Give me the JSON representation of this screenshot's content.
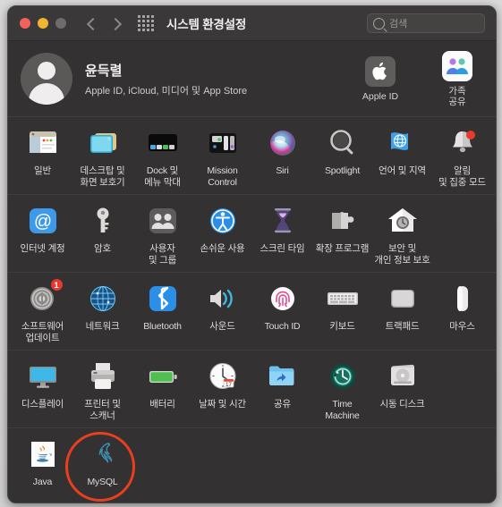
{
  "window": {
    "title": "시스템 환경설정",
    "traffic_lights": [
      "close",
      "minimize",
      "maximize"
    ],
    "nav_back": "back-arrow",
    "nav_forward": "forward-arrow",
    "grid_button": "show-all-grid",
    "search": {
      "placeholder": "검색",
      "value": ""
    }
  },
  "account": {
    "name": "윤득렬",
    "subtitle": "Apple ID, iCloud, 미디어 및 App Store",
    "avatar": "default-user-avatar",
    "actions": [
      {
        "label": "Apple ID",
        "icon": "apple-logo-icon"
      },
      {
        "label": "가족\n공유",
        "label_line1": "가족",
        "label_line2": "공유",
        "icon": "family-sharing-icon"
      }
    ]
  },
  "rows": [
    {
      "items": [
        {
          "label_line1": "일반",
          "label_line2": "",
          "icon": "general-icon"
        },
        {
          "label_line1": "데스크탑 및",
          "label_line2": "화면 보호기",
          "icon": "desktop-screensaver-icon"
        },
        {
          "label_line1": "Dock 및",
          "label_line2": "메뉴 막대",
          "icon": "dock-menubar-icon"
        },
        {
          "label_line1": "Mission",
          "label_line2": "Control",
          "icon": "mission-control-icon"
        },
        {
          "label_line1": "Siri",
          "label_line2": "",
          "icon": "siri-icon"
        },
        {
          "label_line1": "Spotlight",
          "label_line2": "",
          "icon": "spotlight-icon"
        },
        {
          "label_line1": "언어 및 지역",
          "label_line2": "",
          "icon": "language-region-icon"
        },
        {
          "label_line1": "알림",
          "label_line2": "및 집중 모드",
          "icon": "notifications-focus-icon"
        }
      ]
    },
    {
      "items": [
        {
          "label_line1": "인터넷 계정",
          "label_line2": "",
          "icon": "internet-accounts-icon"
        },
        {
          "label_line1": "암호",
          "label_line2": "",
          "icon": "passwords-icon"
        },
        {
          "label_line1": "사용자",
          "label_line2": "및 그룹",
          "icon": "users-groups-icon"
        },
        {
          "label_line1": "손쉬운 사용",
          "label_line2": "",
          "icon": "accessibility-icon"
        },
        {
          "label_line1": "스크린 타임",
          "label_line2": "",
          "icon": "screen-time-icon"
        },
        {
          "label_line1": "확장 프로그램",
          "label_line2": "",
          "icon": "extensions-icon"
        },
        {
          "label_line1": "보안 및",
          "label_line2": "개인 정보 보호",
          "icon": "security-privacy-icon"
        }
      ]
    },
    {
      "items": [
        {
          "label_line1": "소프트웨어",
          "label_line2": "업데이트",
          "icon": "software-update-icon",
          "badge": "1"
        },
        {
          "label_line1": "네트워크",
          "label_line2": "",
          "icon": "network-icon"
        },
        {
          "label_line1": "Bluetooth",
          "label_line2": "",
          "icon": "bluetooth-icon"
        },
        {
          "label_line1": "사운드",
          "label_line2": "",
          "icon": "sound-icon"
        },
        {
          "label_line1": "Touch ID",
          "label_line2": "",
          "icon": "touch-id-icon"
        },
        {
          "label_line1": "키보드",
          "label_line2": "",
          "icon": "keyboard-icon"
        },
        {
          "label_line1": "트랙패드",
          "label_line2": "",
          "icon": "trackpad-icon"
        },
        {
          "label_line1": "마우스",
          "label_line2": "",
          "icon": "mouse-icon"
        }
      ]
    },
    {
      "items": [
        {
          "label_line1": "디스플레이",
          "label_line2": "",
          "icon": "displays-icon"
        },
        {
          "label_line1": "프린터 및",
          "label_line2": "스캐너",
          "icon": "printers-scanners-icon"
        },
        {
          "label_line1": "배터리",
          "label_line2": "",
          "icon": "battery-icon"
        },
        {
          "label_line1": "날짜 및 시간",
          "label_line2": "",
          "icon": "date-time-icon"
        },
        {
          "label_line1": "공유",
          "label_line2": "",
          "icon": "sharing-icon"
        },
        {
          "label_line1": "Time",
          "label_line2": "Machine",
          "icon": "time-machine-icon"
        },
        {
          "label_line1": "시동 디스크",
          "label_line2": "",
          "icon": "startup-disk-icon"
        }
      ]
    },
    {
      "items": [
        {
          "label_line1": "Java",
          "label_line2": "",
          "icon": "java-icon"
        },
        {
          "label_line1": "MySQL",
          "label_line2": "",
          "icon": "mysql-dolphin-icon",
          "annotated": true
        }
      ]
    }
  ],
  "annotation": {
    "shape": "circle",
    "color": "#e8401f",
    "target": "MySQL"
  },
  "colors": {
    "window_bg": "#333131",
    "titlebar_bg": "#3a3838",
    "accent_red": "#e8401f",
    "badge_red": "#e8392e",
    "text_primary": "#dedbdb"
  }
}
